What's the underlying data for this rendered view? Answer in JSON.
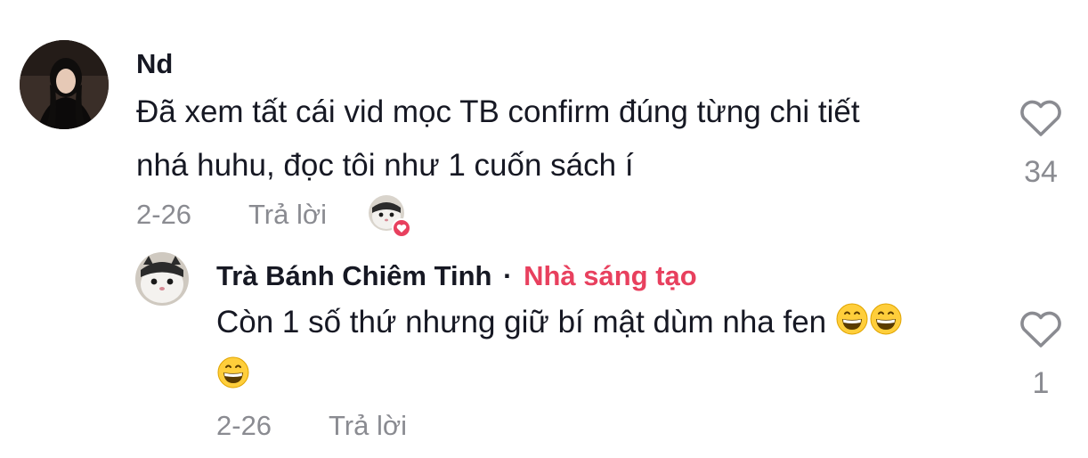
{
  "comment": {
    "author": "Nd",
    "text_line1": "Đã xem tất cái vid mọc TB confirm đúng từng chi tiết",
    "text_line2": "nhá huhu, đọc tôi như 1 cuốn sách í",
    "date": "2-26",
    "reply_label": "Trả lời",
    "like_count": "34",
    "icons": {
      "like": "heart-outline-icon",
      "creator_liked": "creator-liked-heart-icon"
    }
  },
  "reply": {
    "author": "Trà Bánh Chiêm Tinh",
    "separator": "·",
    "creator_badge": "Nhà sáng tạo",
    "text": "Còn 1 số thứ nhưng giữ bí mật dùm nha fen",
    "emojis": [
      "grinning-face-emoji",
      "grinning-face-emoji",
      "grinning-face-emoji"
    ],
    "date": "2-26",
    "reply_label": "Trả lời",
    "like_count": "1"
  },
  "colors": {
    "creator": "#e8405e",
    "muted": "#8a8b91",
    "text": "#161823"
  }
}
